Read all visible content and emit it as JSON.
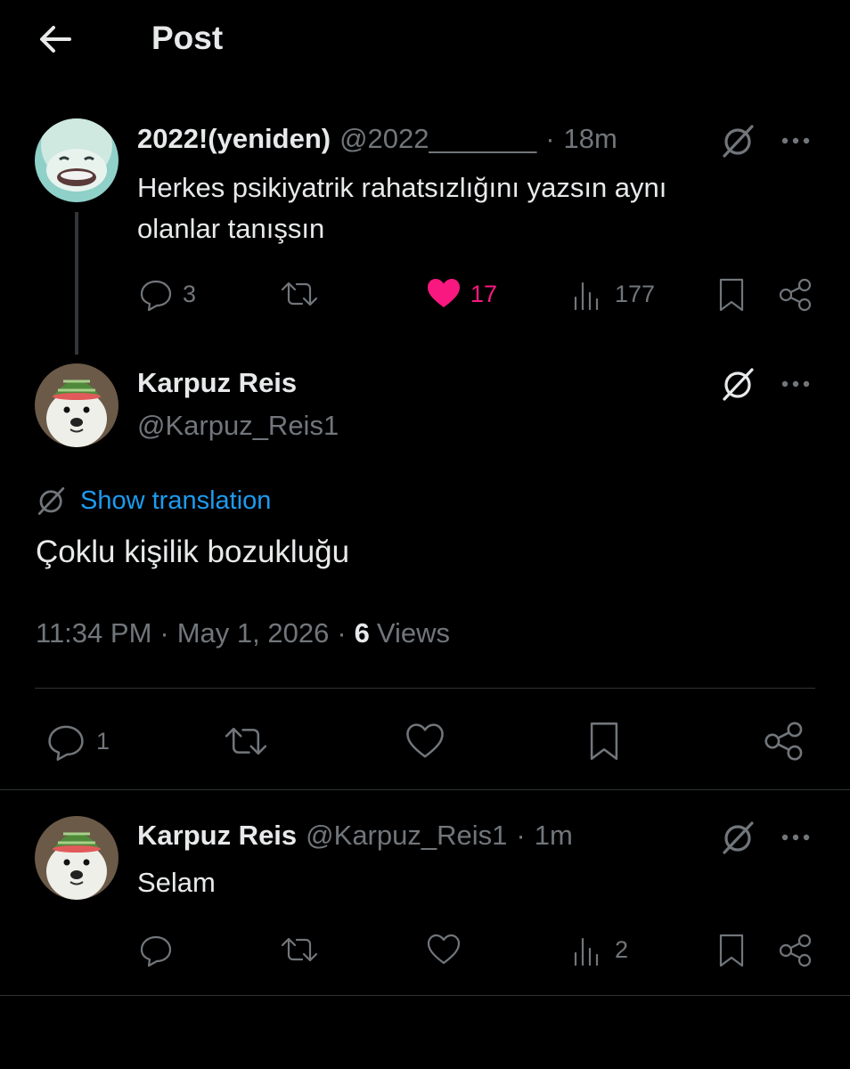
{
  "header": {
    "title": "Post"
  },
  "parent_post": {
    "display_name": "2022!(yeniden)",
    "handle": "@2022_______",
    "separator": "·",
    "time": "18m",
    "text_line1": "Herkes psikiyatrik rahatsızlığını yazsın aynı",
    "text_line2": "olanlar tanışsın",
    "replies": "3",
    "likes": "17",
    "liked": true,
    "views": "177",
    "like_color": "#f91880"
  },
  "main_post": {
    "display_name": "Karpuz Reis",
    "handle": "@Karpuz_Reis1",
    "translate_label": "Show translation",
    "text": "Çoklu kişilik bozukluğu",
    "time": "11:34 PM",
    "sep1": "·",
    "date": "May 1, 2026",
    "sep2": "·",
    "views_count": "6",
    "views_label": "Views",
    "replies": "1",
    "link_color": "#1d9bf0"
  },
  "reply_post": {
    "display_name": "Karpuz Reis",
    "handle": "@Karpuz_Reis1",
    "separator": "·",
    "time": "1m",
    "text": "Selam",
    "views": "2"
  }
}
